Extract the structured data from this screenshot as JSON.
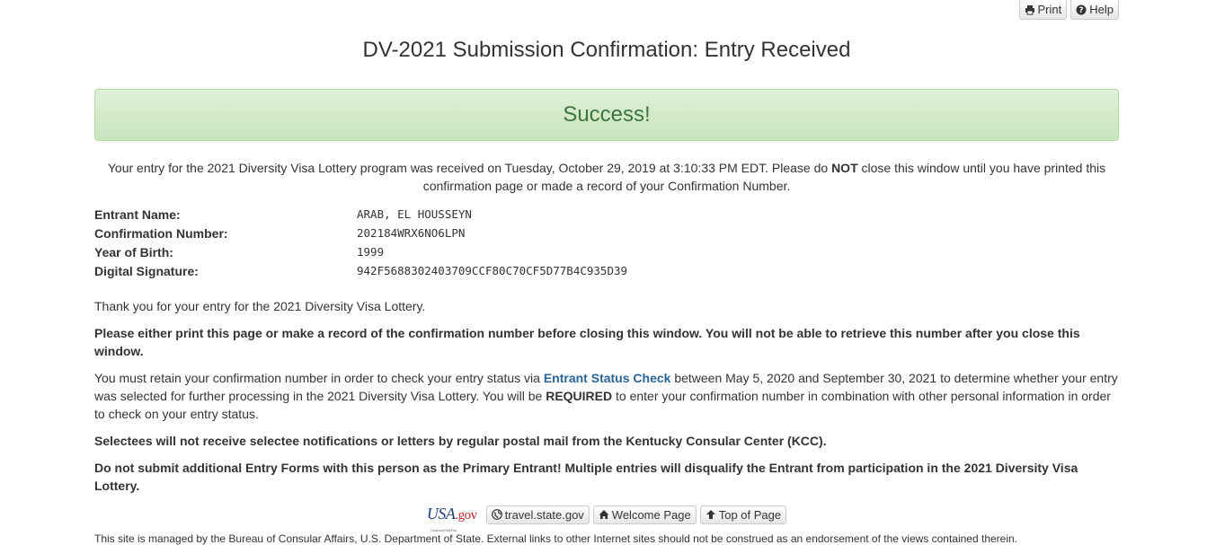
{
  "toolbar": {
    "print_label": "Print",
    "help_label": "Help"
  },
  "page_title": "DV-2021 Submission Confirmation: Entry Received",
  "alert": {
    "text": "Success!",
    "color": "#3c763d"
  },
  "intro": {
    "part1": "Your entry for the 2021 Diversity Visa Lottery program was received on Tuesday, October 29, 2019 at 3:10:33 PM EDT. Please do ",
    "emph": "NOT",
    "part2": " close this window until you have printed this confirmation page or made a record of your Confirmation Number."
  },
  "fields": [
    {
      "label": "Entrant Name:",
      "value": "ARAB, EL HOUSSEYN"
    },
    {
      "label": "Confirmation Number:",
      "value": "202184WRX6NO6LPN"
    },
    {
      "label": "Year of Birth:",
      "value": "1999"
    },
    {
      "label": "Digital Signature:",
      "value": "942F5688302403709CCF80C70CF5D77B4C935D39"
    }
  ],
  "thanks": "Thank you for your entry for the 2021 Diversity Visa Lottery.",
  "warning_print": "Please either print this page or make a record of the confirmation number before closing this window. You will not be able to retrieve this number after you close this window.",
  "retain": {
    "part1": "You must retain your confirmation number in order to check your entry status via ",
    "link": "Entrant Status Check",
    "part2": " between May 5, 2020 and September 30, 2021 to determine whether your entry was selected for further processing in the 2021 Diversity Visa Lottery. You will be ",
    "emph": "REQUIRED",
    "part3": " to enter your confirmation number in combination with other personal information in order to check on your entry status."
  },
  "selectees": "Selectees will not receive selectee notifications or letters by regular postal mail from the Kentucky Consular Center (KCC).",
  "do_not_submit": "Do not submit additional Entry Forms with this person as the Primary Entrant! Multiple entries will disqualify the Entrant from participation in the 2021 Diversity Visa Lottery.",
  "footer": {
    "usagov_main": "USA",
    "usagov_gov": ".gov",
    "usagov_sub": "Government Made Easy",
    "links": [
      {
        "label": "travel.state.gov",
        "icon": "globe-icon"
      },
      {
        "label": "Welcome Page",
        "icon": "home-icon"
      },
      {
        "label": "Top of Page",
        "icon": "arrow-up-icon"
      }
    ],
    "disclaimer": "This site is managed by the Bureau of Consular Affairs, U.S. Department of State. External links to other Internet sites should not be construed as an endorsement of the views contained therein."
  }
}
